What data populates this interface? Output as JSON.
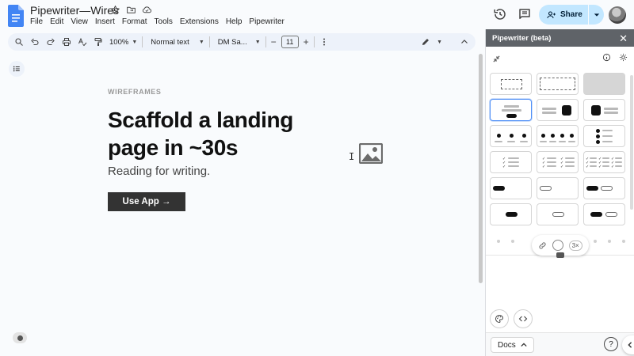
{
  "app": {
    "doc_title": "Pipewriter—Wires",
    "menu": [
      "File",
      "Edit",
      "View",
      "Insert",
      "Format",
      "Tools",
      "Extensions",
      "Help",
      "Pipewriter"
    ],
    "share_label": "Share"
  },
  "toolbar": {
    "zoom": "100%",
    "style": "Normal text",
    "font": "DM Sa...",
    "font_size": "11",
    "minus": "−",
    "plus": "+"
  },
  "document": {
    "eyebrow": "WIREFRAMES",
    "headline": "Scaffold a landing page in ~30s",
    "subhead": "Reading for writing.",
    "cta": "Use App →",
    "cursor": "I"
  },
  "panel": {
    "title": "Pipewriter (beta)",
    "close": "✕",
    "floating_label": "3×",
    "footer_tab": "Docs",
    "help": "?"
  },
  "colors": {
    "share_bg": "#c2e7ff",
    "selected_tile": "#4c8df6",
    "panel_header": "#5f6368",
    "cta_bg": "#333333",
    "docs_blue": "#4285f4"
  }
}
